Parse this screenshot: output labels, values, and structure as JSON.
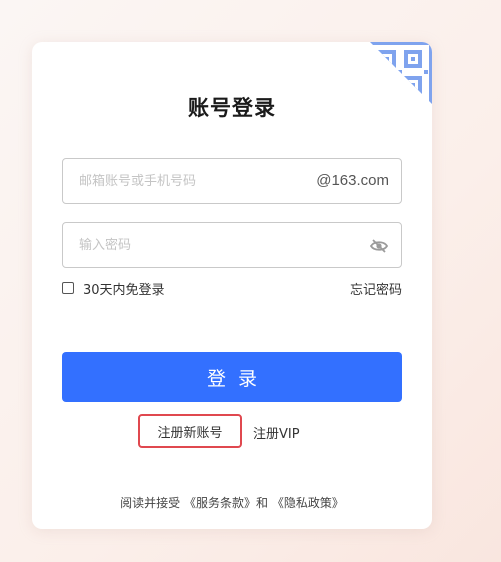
{
  "login": {
    "title": "账号登录",
    "email_placeholder": "邮箱账号或手机号码",
    "email_value": "",
    "domain_suffix": "@163.com",
    "password_placeholder": "输入密码",
    "password_value": "",
    "remember_label": "30天内免登录",
    "remember_checked": false,
    "forgot_label": "忘记密码",
    "login_button": "登录",
    "register_new": "注册新账号",
    "register_vip": "注册VIP",
    "agreement_prefix": "阅读并接受",
    "terms_link": "《服务条款》",
    "agreement_and": "和",
    "privacy_link": "《隐私政策》"
  },
  "icons": {
    "qr_corner": "qr-code-icon",
    "password_toggle": "eye-off-icon",
    "remember_checkbox": "checkbox-icon"
  },
  "colors": {
    "accent": "#3370ff",
    "highlight_border": "#e0484f",
    "qr_icon": "#7fa3ee",
    "background": "#fbefea"
  }
}
